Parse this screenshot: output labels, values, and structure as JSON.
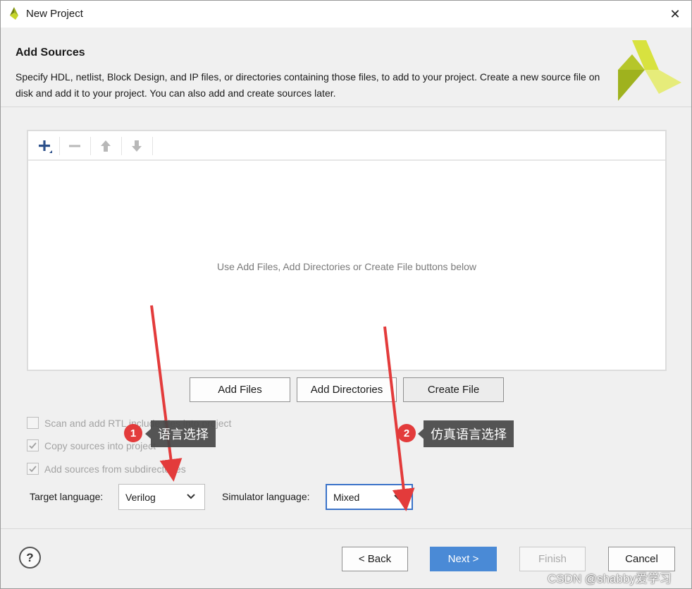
{
  "window": {
    "title": "New Project",
    "close_glyph": "✕"
  },
  "header": {
    "title": "Add Sources",
    "description": "Specify HDL, netlist, Block Design, and IP files, or directories containing those files, to add to your project. Create a new source file on disk and add it to your project. You can also add and create sources later."
  },
  "toolbar": {
    "add_icon": "plus-icon",
    "remove_icon": "minus-icon",
    "up_icon": "arrow-up-icon",
    "down_icon": "arrow-down-icon"
  },
  "sources": {
    "empty_message": "Use Add Files, Add Directories or Create File buttons below",
    "items": []
  },
  "buttons": {
    "add_files": "Add Files",
    "add_directories": "Add Directories",
    "create_file": "Create File"
  },
  "options": {
    "scan_rtl": {
      "label": "Scan and add RTL include files into project",
      "checked": false
    },
    "copy_sources": {
      "label": "Copy sources into project",
      "checked": true
    },
    "add_subdirs": {
      "label": "Add sources from subdirectories",
      "checked": true
    }
  },
  "target_language": {
    "label": "Target language:",
    "value": "Verilog"
  },
  "simulator_language": {
    "label": "Simulator language:",
    "value": "Mixed"
  },
  "annotations": [
    {
      "number": "1",
      "text": "语言选择"
    },
    {
      "number": "2",
      "text": "仿真语言选择"
    }
  ],
  "footer": {
    "help": "?",
    "back": "< Back",
    "next": "Next >",
    "finish": "Finish",
    "cancel": "Cancel"
  },
  "watermark": "CSDN @shabby爱学习",
  "colors": {
    "accent": "#4a8ad6",
    "annotation_red": "#e33b3b",
    "logo_green": "#9fb21e"
  }
}
